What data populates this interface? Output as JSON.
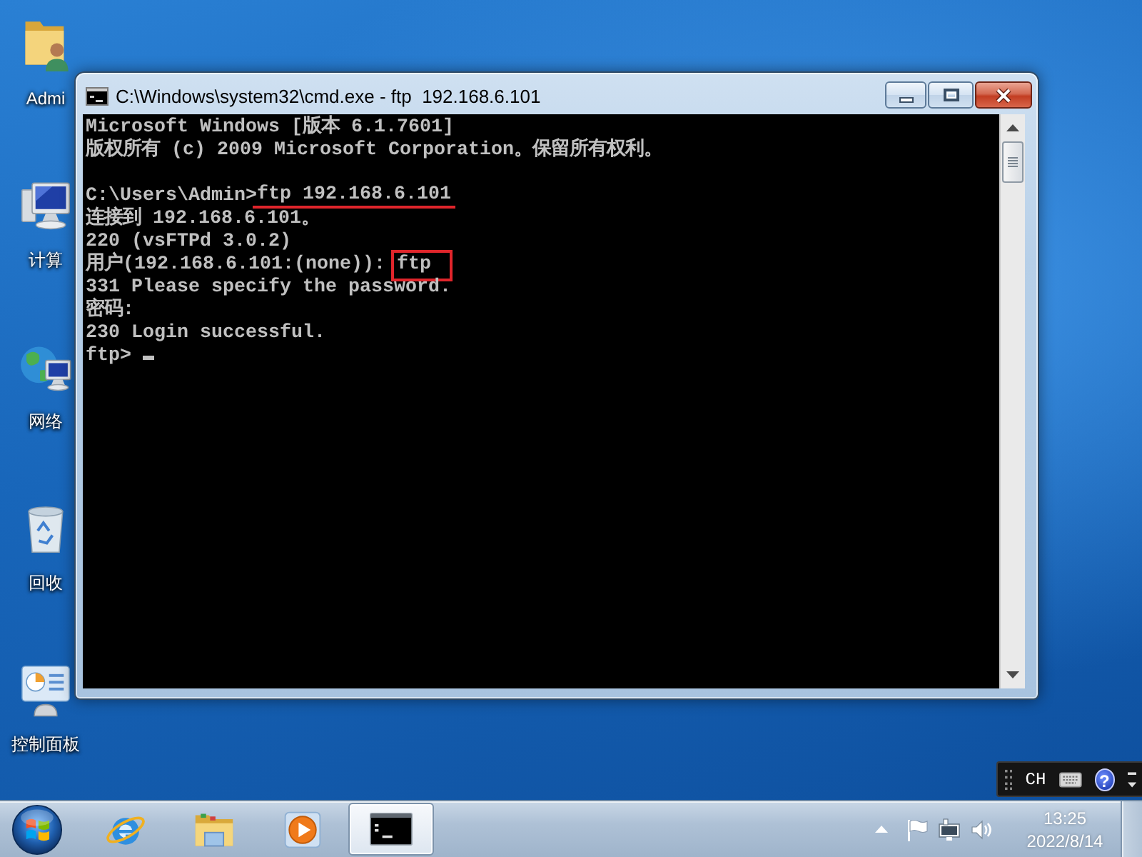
{
  "desktop": {
    "icons": [
      {
        "kind": "user-folder",
        "label": "Admi"
      },
      {
        "kind": "computer",
        "label": "计算"
      },
      {
        "kind": "network",
        "label": "网络"
      },
      {
        "kind": "recycle-bin",
        "label": "回收"
      },
      {
        "kind": "control-panel",
        "label": "控制面板"
      }
    ]
  },
  "window": {
    "title": "C:\\Windows\\system32\\cmd.exe - ftp  192.168.6.101",
    "console": {
      "blocks": [
        {
          "lines": [
            {
              "text": "Microsoft Windows [版本 6.1.7601]"
            },
            {
              "text": "版权所有 (c) 2009 Microsoft Corporation。保留所有权利。"
            }
          ]
        },
        {
          "lines": [
            {
              "prompt": "C:\\Users\\Admin>",
              "input": "ftp 192.168.6.101",
              "underlined": true
            },
            {
              "text": "连接到 192.168.6.101。"
            },
            {
              "text": "220 (vsFTPd 3.0.2)"
            },
            {
              "prompt": "用户(192.168.6.101:(none)): ",
              "input": "ftp",
              "boxed": true
            },
            {
              "text": "331 Please specify the password."
            },
            {
              "text": "密码:"
            },
            {
              "text": "230 Login successful."
            },
            {
              "prompt": "ftp> ",
              "cursor": true
            }
          ]
        }
      ]
    }
  },
  "language_bar": {
    "label": "CH",
    "help": "?"
  },
  "taskbar": {
    "buttons": [
      {
        "kind": "browser",
        "selected": false
      },
      {
        "kind": "folder",
        "selected": false
      },
      {
        "kind": "media",
        "selected": false
      },
      {
        "kind": "console",
        "selected": true
      }
    ],
    "clock": {
      "time": "13:25",
      "date": "2022/8/14"
    }
  }
}
